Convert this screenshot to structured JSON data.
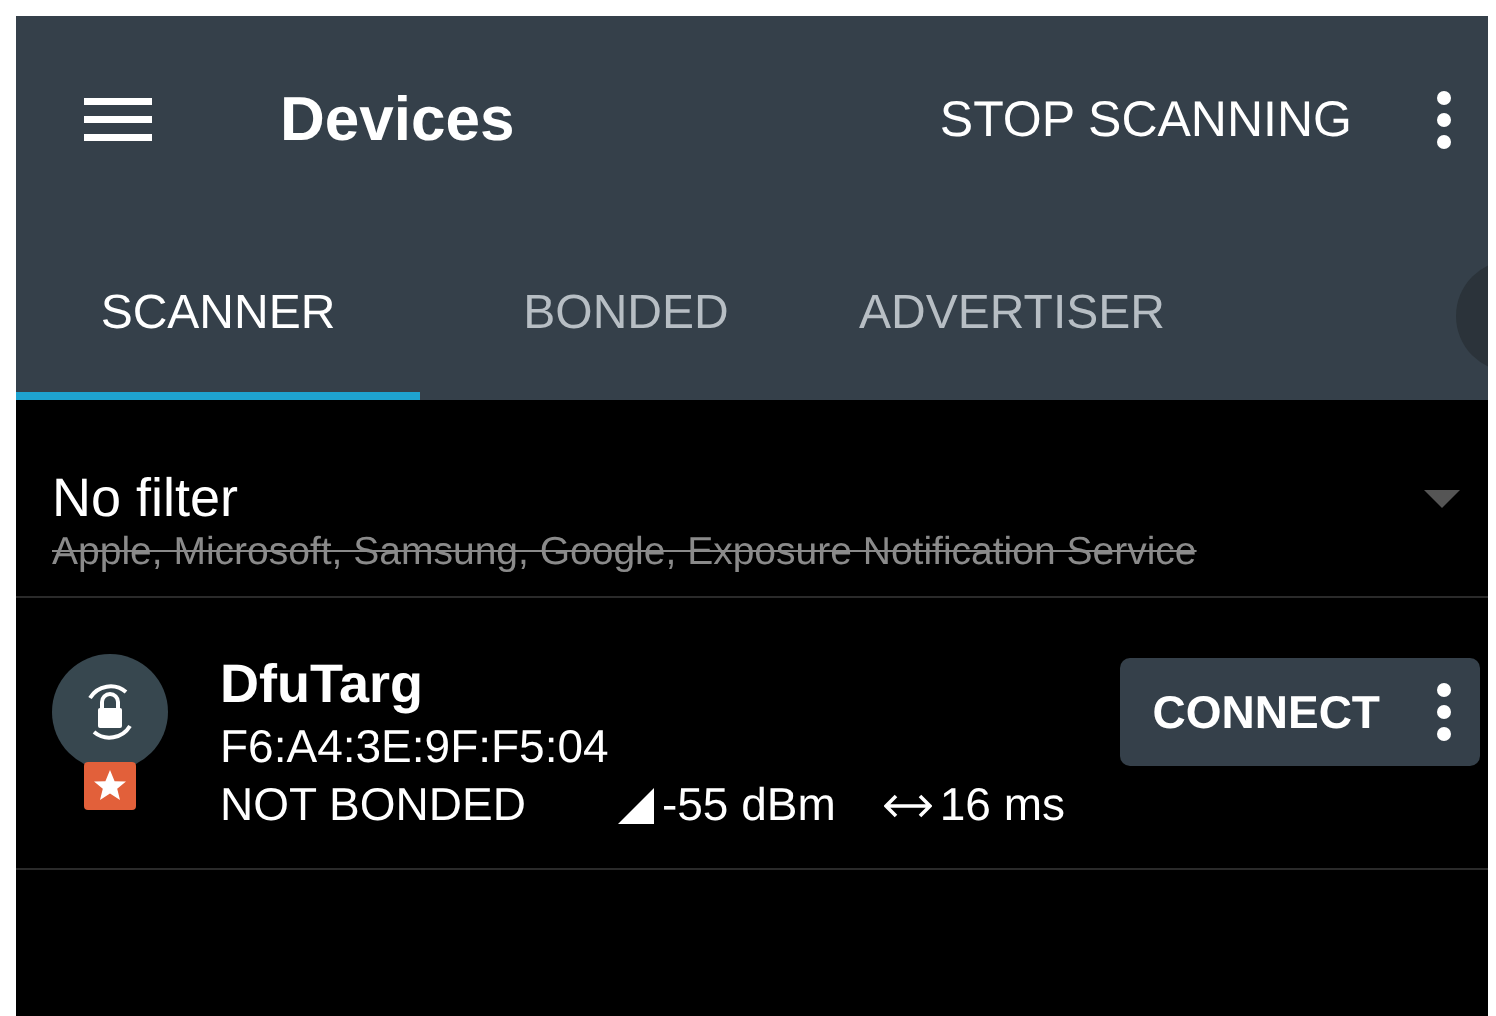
{
  "toolbar": {
    "title": "Devices",
    "action": "STOP SCANNING"
  },
  "tabs": [
    {
      "label": "SCANNER",
      "selected": true
    },
    {
      "label": "BONDED",
      "selected": false
    },
    {
      "label": "ADVERTISER",
      "selected": false
    }
  ],
  "filter": {
    "title": "No filter",
    "excluded": "Apple, Microsoft, Samsung, Google, Exposure Notification Service",
    "struck_out": true
  },
  "devices": [
    {
      "name": "DfuTarg",
      "address": "F6:A4:3E:9F:F5:04",
      "bond_state": "NOT BONDED",
      "rssi": "-55 dBm",
      "interval": "16 ms",
      "favorite": true,
      "button": "CONNECT"
    }
  ]
}
